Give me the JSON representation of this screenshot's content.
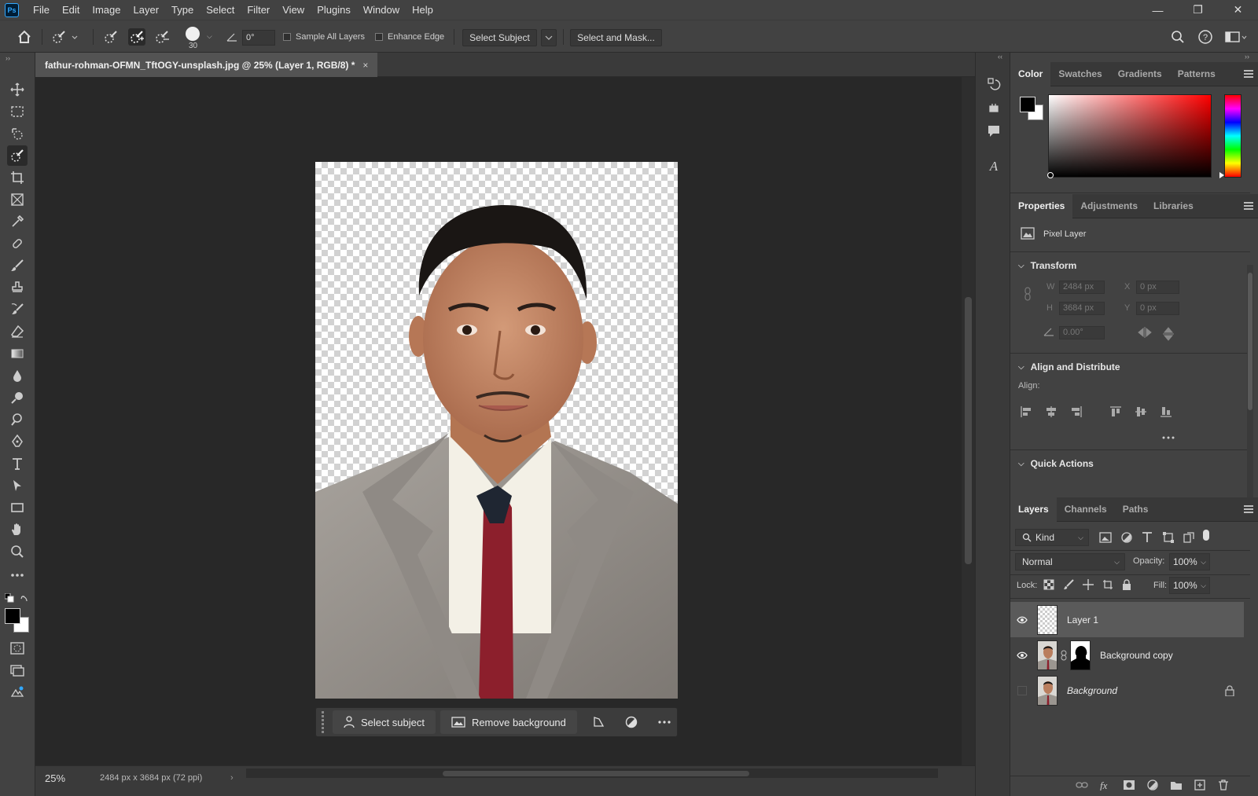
{
  "app": {
    "logo": "Ps"
  },
  "menu": [
    "File",
    "Edit",
    "Image",
    "Layer",
    "Type",
    "Select",
    "Filter",
    "View",
    "Plugins",
    "Window",
    "Help"
  ],
  "window_controls": {
    "minimize": "—",
    "restore": "❐",
    "close": "✕"
  },
  "options_bar": {
    "brush_size": "30",
    "angle": "0°",
    "sample_all_layers": "Sample All Layers",
    "enhance_edge": "Enhance Edge",
    "select_subject": "Select Subject",
    "select_and_mask": "Select and Mask..."
  },
  "document": {
    "tab_title": "fathur-rohman-OFMN_TftOGY-unsplash.jpg @ 25% (Layer 1, RGB/8) *",
    "close_glyph": "×",
    "zoom": "25%",
    "dimensions": "2484 px x 3684 px (72 ppi)"
  },
  "taskbar": {
    "select_subject": "Select subject",
    "remove_background": "Remove background"
  },
  "color_panel": {
    "tabs": [
      "Color",
      "Swatches",
      "Gradients",
      "Patterns"
    ],
    "hue": "#ff0000"
  },
  "properties_panel": {
    "tabs": [
      "Properties",
      "Adjustments",
      "Libraries"
    ],
    "layer_type": "Pixel Layer",
    "transform_title": "Transform",
    "w_label": "W",
    "w_value": "2484 px",
    "h_label": "H",
    "h_value": "3684 px",
    "x_label": "X",
    "x_value": "0 px",
    "y_label": "Y",
    "y_value": "0 px",
    "angle_value": "0.00°",
    "align_title": "Align and Distribute",
    "align_label": "Align:",
    "quick_actions": "Quick Actions"
  },
  "layers_panel": {
    "tabs": [
      "Layers",
      "Channels",
      "Paths"
    ],
    "kind": "Kind",
    "blend_mode": "Normal",
    "opacity_label": "Opacity:",
    "opacity": "100%",
    "lock_label": "Lock:",
    "fill_label": "Fill:",
    "fill": "100%",
    "layers": [
      {
        "name": "Layer 1",
        "visible": true,
        "selected": true
      },
      {
        "name": "Background copy",
        "visible": true,
        "selected": false
      },
      {
        "name": "Background",
        "visible": false,
        "selected": false,
        "locked": true
      }
    ]
  }
}
